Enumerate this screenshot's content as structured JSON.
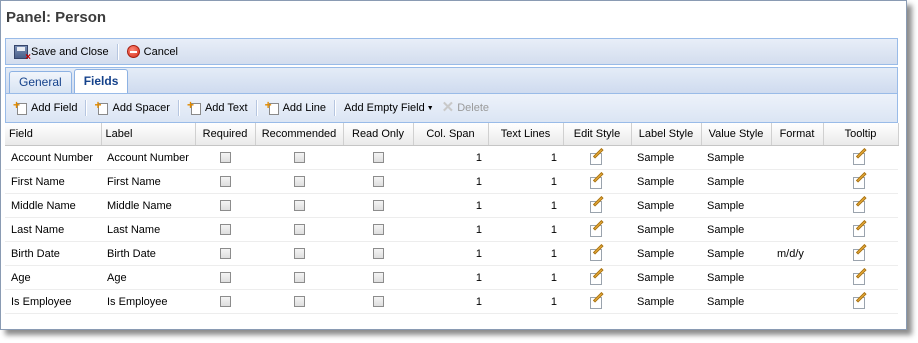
{
  "panel": {
    "title": "Panel: Person"
  },
  "toolbar": {
    "save_close": "Save and Close",
    "cancel": "Cancel"
  },
  "tabs": [
    {
      "label": "General"
    },
    {
      "label": "Fields"
    }
  ],
  "gridbar": {
    "add_field": "Add Field",
    "add_spacer": "Add Spacer",
    "add_text": "Add Text",
    "add_line": "Add Line",
    "add_empty_field": "Add Empty Field",
    "delete": "Delete"
  },
  "grid": {
    "columns": [
      "Field",
      "Label",
      "Required",
      "Recommended",
      "Read Only",
      "Col. Span",
      "Text Lines",
      "Edit Style",
      "Label Style",
      "Value Style",
      "Format",
      "Tooltip"
    ],
    "rows": [
      {
        "field": "Account Number",
        "label": "Account Number",
        "col_span": "1",
        "text_lines": "1",
        "label_style": "Sample",
        "value_style": "Sample",
        "format": ""
      },
      {
        "field": "First Name",
        "label": "First Name",
        "col_span": "1",
        "text_lines": "1",
        "label_style": "Sample",
        "value_style": "Sample",
        "format": ""
      },
      {
        "field": "Middle Name",
        "label": "Middle Name",
        "col_span": "1",
        "text_lines": "1",
        "label_style": "Sample",
        "value_style": "Sample",
        "format": ""
      },
      {
        "field": "Last Name",
        "label": "Last Name",
        "col_span": "1",
        "text_lines": "1",
        "label_style": "Sample",
        "value_style": "Sample",
        "format": ""
      },
      {
        "field": "Birth Date",
        "label": "Birth Date",
        "col_span": "1",
        "text_lines": "1",
        "label_style": "Sample",
        "value_style": "Sample",
        "format": "m/d/y"
      },
      {
        "field": "Age",
        "label": "Age",
        "col_span": "1",
        "text_lines": "1",
        "label_style": "Sample",
        "value_style": "Sample",
        "format": ""
      },
      {
        "field": "Is Employee",
        "label": "Is Employee",
        "col_span": "1",
        "text_lines": "1",
        "label_style": "Sample",
        "value_style": "Sample",
        "format": ""
      }
    ]
  }
}
